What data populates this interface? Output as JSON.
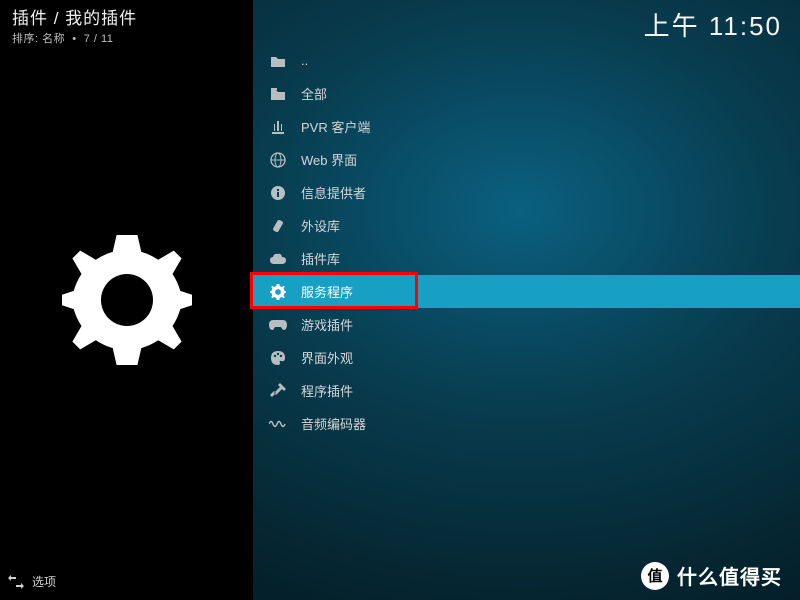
{
  "header": {
    "breadcrumb": "插件 / 我的插件",
    "sort_label": "排序: 名称",
    "position": "7 / 11",
    "clock": "上午 11:50"
  },
  "list": [
    {
      "icon": "folder-up-icon",
      "label": ".."
    },
    {
      "icon": "folder-icon",
      "label": "全部"
    },
    {
      "icon": "antenna-icon",
      "label": "PVR 客户端"
    },
    {
      "icon": "globe-icon",
      "label": "Web 界面"
    },
    {
      "icon": "info-icon",
      "label": "信息提供者"
    },
    {
      "icon": "device-icon",
      "label": "外设库"
    },
    {
      "icon": "cloud-icon",
      "label": "插件库"
    },
    {
      "icon": "gear-icon",
      "label": "服务程序",
      "selected": true,
      "highlighted": true
    },
    {
      "icon": "gamepad-icon",
      "label": "游戏插件"
    },
    {
      "icon": "palette-icon",
      "label": "界面外观"
    },
    {
      "icon": "tools-icon",
      "label": "程序插件"
    },
    {
      "icon": "wave-icon",
      "label": "音频编码器"
    }
  ],
  "footer": {
    "options_label": "选项",
    "brand_badge": "值",
    "brand_text": "什么值得买"
  },
  "colors": {
    "accent": "#17a0c4",
    "highlight": "#ff0000"
  }
}
